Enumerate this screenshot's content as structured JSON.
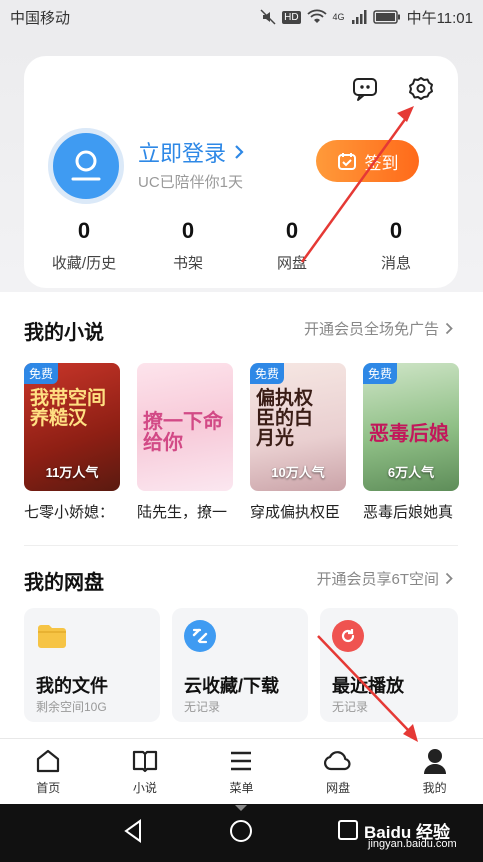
{
  "status_bar": {
    "carrier": "中国移动",
    "signal_label": "4G",
    "hd_label": "HD",
    "time": "中午11:01"
  },
  "profile": {
    "login_text": "立即登录",
    "companion_text": "UC已陪伴你1天",
    "checkin_label": "签到",
    "stats": [
      {
        "value": "0",
        "label": "收藏/历史"
      },
      {
        "value": "0",
        "label": "书架"
      },
      {
        "value": "0",
        "label": "网盘"
      },
      {
        "value": "0",
        "label": "消息"
      }
    ]
  },
  "novels": {
    "title": "我的小说",
    "link": "开通会员全场免广告",
    "books": [
      {
        "title": "七零小娇媳：",
        "tag": "免费",
        "popularity": "11万人气",
        "cover_text": "我带空间养糙汉"
      },
      {
        "title": "陆先生，撩一",
        "tag": "",
        "popularity": "",
        "cover_text": "撩一下命给你"
      },
      {
        "title": "穿成偏执权臣",
        "tag": "免费",
        "popularity": "10万人气",
        "cover_text": "偏执权臣的白月光"
      },
      {
        "title": "恶毒后娘她真",
        "tag": "免费",
        "popularity": "6万人气",
        "cover_text": "恶毒后娘"
      }
    ]
  },
  "cloud": {
    "title": "我的网盘",
    "link": "开通会员享6T空间",
    "tiles": [
      {
        "name": "我的文件",
        "sub": "剩余空间10G",
        "icon": "folder-icon",
        "color": "#f6c445"
      },
      {
        "name": "云收藏/下载",
        "sub": "无记录",
        "icon": "cloud-download-icon",
        "color": "#3f9bf2"
      },
      {
        "name": "最近播放",
        "sub": "无记录",
        "icon": "replay-icon",
        "color": "#ef5350"
      }
    ]
  },
  "tabbar": {
    "tabs": [
      {
        "label": "首页",
        "icon": "home-icon"
      },
      {
        "label": "小说",
        "icon": "book-icon"
      },
      {
        "label": "菜单",
        "icon": "menu-icon"
      },
      {
        "label": "网盘",
        "icon": "cloud-icon"
      },
      {
        "label": "我的",
        "icon": "person-icon",
        "active": true
      }
    ]
  },
  "watermark": {
    "brand": "Baidu 经验",
    "url": "jingyan.baidu.com"
  },
  "colors": {
    "accent_blue": "#2e88e6",
    "checkin_orange": "#ff7a22",
    "annotation_red": "#e53935"
  }
}
